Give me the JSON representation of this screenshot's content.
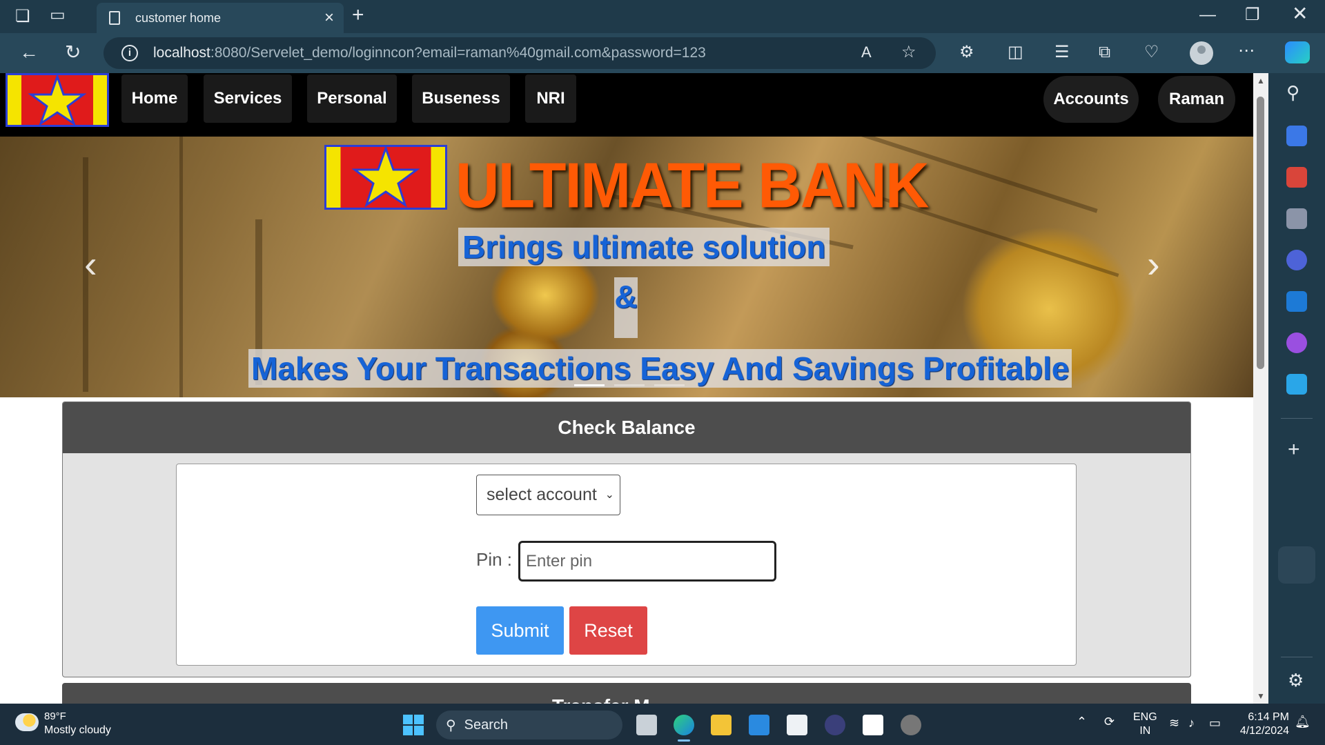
{
  "browser": {
    "tab_title": "customer home",
    "url_host": "localhost",
    "url_rest": ":8080/Servelet_demo/loginncon?email=raman%40gmail.com&password=123"
  },
  "nav": {
    "left_items": [
      {
        "label": "Home"
      },
      {
        "label": "Services"
      },
      {
        "label": "Personal"
      },
      {
        "label": "Buseness"
      },
      {
        "label": "NRI"
      }
    ],
    "right_items": [
      {
        "label": "Accounts"
      },
      {
        "label": "Raman"
      }
    ]
  },
  "banner": {
    "title": "ULTIMATE BANK",
    "line1": "Brings ultimate solution",
    "line2": "&",
    "line3": "Makes Your Transactions Easy And Savings Profitable",
    "prev": "‹",
    "next": "›"
  },
  "check_balance": {
    "heading": "Check Balance",
    "select_value": "select account",
    "pin_label": "Pin :",
    "pin_placeholder": "Enter pin",
    "submit_label": "Submit",
    "reset_label": "Reset"
  },
  "next_section": {
    "heading": "Transfer M"
  },
  "taskbar": {
    "weather_temp": "89°F",
    "weather_desc": "Mostly cloudy",
    "search_label": "Search",
    "lang_top": "ENG",
    "lang_bottom": "IN",
    "time": "6:14 PM",
    "date": "4/12/2024"
  },
  "colors": {
    "accent_submit": "#3e97f2",
    "accent_reset": "#de4545",
    "title_orange": "#ff5a05",
    "tagline_blue": "#1663d6"
  }
}
